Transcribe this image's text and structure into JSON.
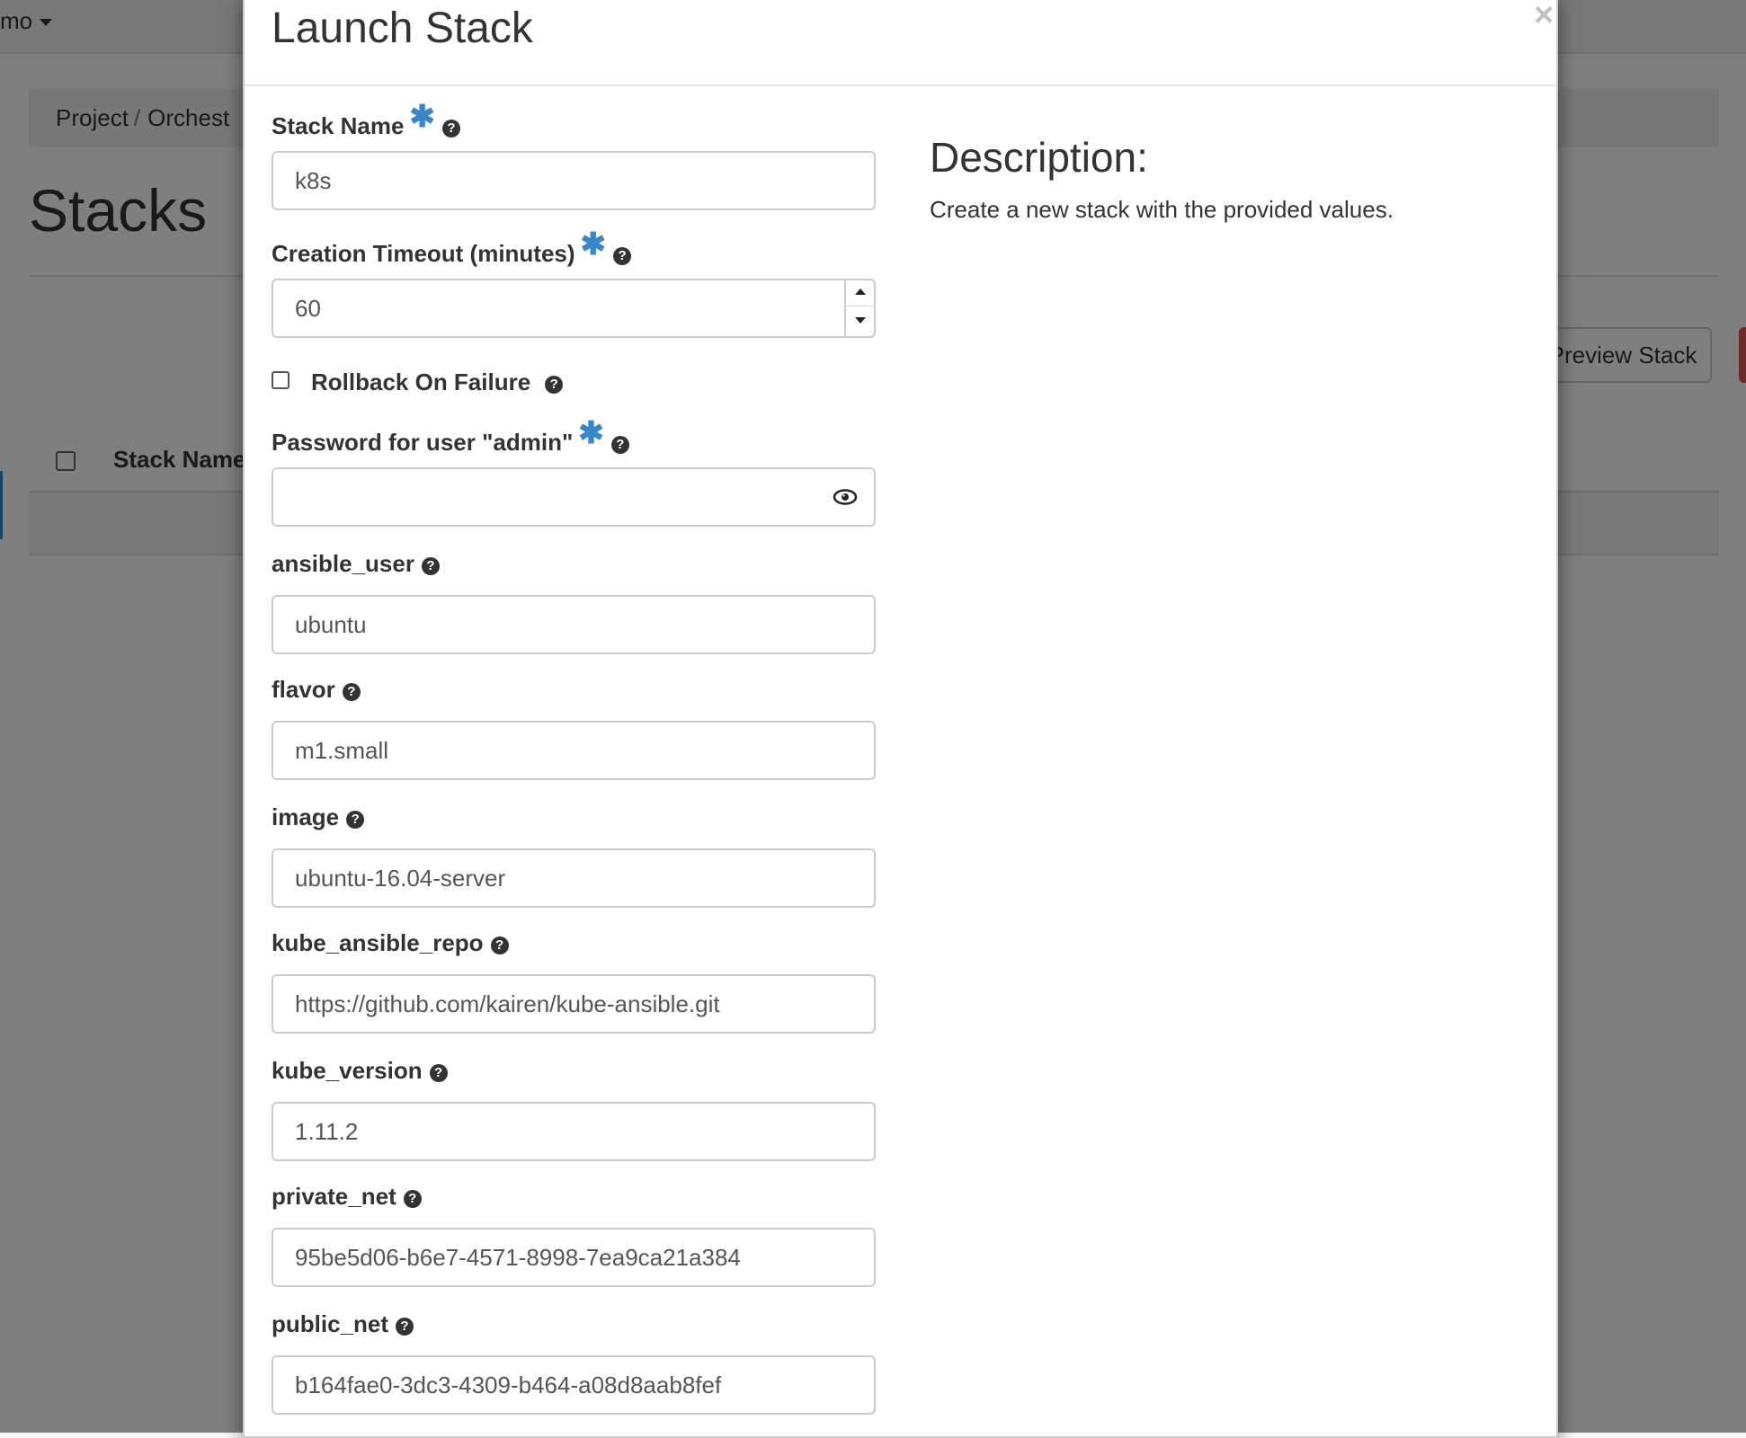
{
  "background": {
    "project_menu": "mo",
    "breadcrumb": [
      "Project",
      "Orchest"
    ],
    "page_title": "Stacks",
    "preview_button": "Preview Stack",
    "table_column": "Stack Name"
  },
  "modal": {
    "title": "Launch Stack",
    "close": "×",
    "description_heading": "Description:",
    "description_text": "Create a new stack with the provided values.",
    "fields": {
      "stack_name": {
        "label": "Stack Name",
        "required": "✱",
        "value": "k8s"
      },
      "creation_timeout": {
        "label": "Creation Timeout (minutes)",
        "required": "✱",
        "value": "60"
      },
      "rollback": {
        "label": "Rollback On Failure",
        "checked": false
      },
      "password": {
        "label": "Password for user \"admin\"",
        "required": "✱",
        "value": ""
      },
      "ansible_user": {
        "label": "ansible_user",
        "value": "ubuntu"
      },
      "flavor": {
        "label": "flavor",
        "value": "m1.small"
      },
      "image": {
        "label": "image",
        "value": "ubuntu-16.04-server"
      },
      "kube_ansible_repo": {
        "label": "kube_ansible_repo",
        "value": "https://github.com/kairen/kube-ansible.git"
      },
      "kube_version": {
        "label": "kube_version",
        "value": "1.11.2"
      },
      "private_net": {
        "label": "private_net",
        "value": "95be5d06-b6e7-4571-8998-7ea9ca21a384"
      },
      "public_net": {
        "label": "public_net",
        "value": "b164fae0-3dc3-4309-b464-a08d8aab8fef"
      }
    },
    "help_glyph": "?"
  },
  "colors": {
    "accent": "#3a87c8",
    "danger": "#d9534f",
    "overlay": "rgba(0,0,0,0.5)"
  }
}
